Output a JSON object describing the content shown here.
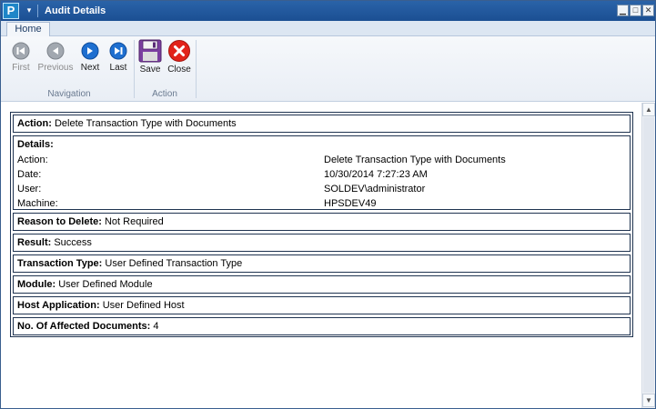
{
  "window": {
    "title": "Audit Details",
    "app_icon_letter": "P"
  },
  "ribbon": {
    "tabs": [
      {
        "label": "Home",
        "active": true
      }
    ],
    "navigation_group": {
      "label": "Navigation",
      "buttons": [
        {
          "label": "First",
          "enabled": false,
          "icon": "first-arrow-icon"
        },
        {
          "label": "Previous",
          "enabled": false,
          "icon": "previous-arrow-icon"
        },
        {
          "label": "Next",
          "enabled": true,
          "icon": "next-arrow-icon"
        },
        {
          "label": "Last",
          "enabled": true,
          "icon": "last-arrow-icon"
        }
      ]
    },
    "action_group": {
      "label": "Action",
      "buttons": [
        {
          "label": "Save",
          "icon": "floppy-disk-icon"
        },
        {
          "label": "Close",
          "icon": "close-circle-icon"
        }
      ]
    }
  },
  "audit": {
    "action": {
      "label": "Action:",
      "value": "Delete Transaction Type with Documents"
    },
    "details": {
      "heading": "Details:",
      "rows": [
        {
          "key": "Action:",
          "value": "Delete Transaction Type with Documents"
        },
        {
          "key": "Date:",
          "value": "10/30/2014 7:27:23 AM"
        },
        {
          "key": "User:",
          "value": "SOLDEV\\administrator"
        },
        {
          "key": "Machine:",
          "value": "HPSDEV49"
        }
      ]
    },
    "reason": {
      "label": "Reason to Delete:",
      "value": "Not Required"
    },
    "result": {
      "label": "Result:",
      "value": "Success"
    },
    "transaction_type": {
      "label": "Transaction Type:",
      "value": "User Defined Transaction Type"
    },
    "module": {
      "label": "Module:",
      "value": "User Defined Module"
    },
    "host_application": {
      "label": "Host Application:",
      "value": "User Defined Host"
    },
    "affected_documents": {
      "label": "No. Of Affected Documents:",
      "value": "4"
    }
  },
  "colors": {
    "titlebar": "#1b4f93",
    "nav_enabled": "#1e6fd0",
    "nav_disabled": "#9aa0a8",
    "close_red": "#e2231a",
    "save_purple": "#7b3fa0"
  }
}
